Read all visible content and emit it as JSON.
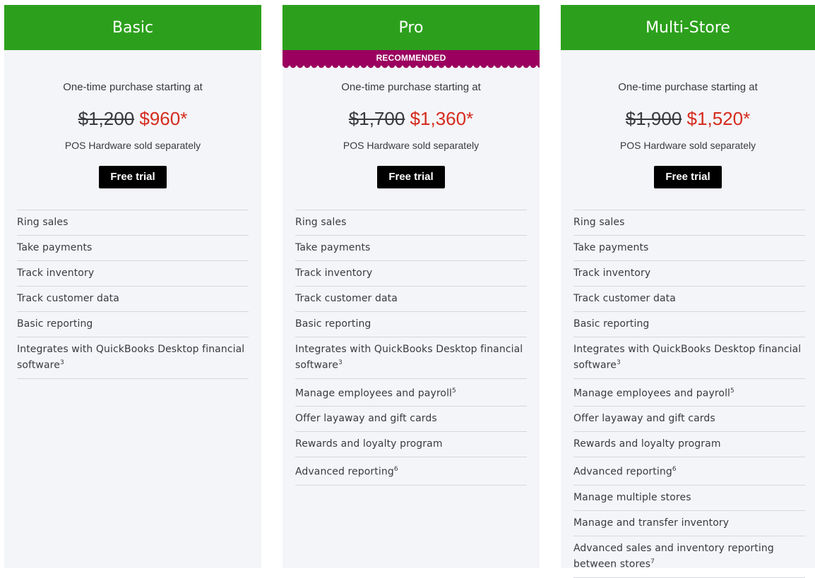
{
  "plans": [
    {
      "name": "Basic",
      "ribbon": null,
      "purchase_label": "One-time purchase starting at",
      "old_price": "$1,200",
      "new_price": "$960*",
      "hardware_note": "POS Hardware sold separately",
      "cta_label": "Free trial",
      "features": [
        {
          "text": "Ring sales",
          "sup": ""
        },
        {
          "text": "Take payments",
          "sup": ""
        },
        {
          "text": "Track inventory",
          "sup": ""
        },
        {
          "text": "Track customer data",
          "sup": ""
        },
        {
          "text": "Basic reporting",
          "sup": ""
        },
        {
          "text": "Integrates with QuickBooks Desktop financial software",
          "sup": "3"
        }
      ]
    },
    {
      "name": "Pro",
      "ribbon": "RECOMMENDED",
      "purchase_label": "One-time purchase starting at",
      "old_price": "$1,700",
      "new_price": "$1,360*",
      "hardware_note": "POS Hardware sold separately",
      "cta_label": "Free trial",
      "features": [
        {
          "text": "Ring sales",
          "sup": ""
        },
        {
          "text": "Take payments",
          "sup": ""
        },
        {
          "text": "Track inventory",
          "sup": ""
        },
        {
          "text": "Track customer data",
          "sup": ""
        },
        {
          "text": "Basic reporting",
          "sup": ""
        },
        {
          "text": "Integrates with QuickBooks Desktop financial software",
          "sup": "3"
        },
        {
          "text": "Manage employees and payroll",
          "sup": "5"
        },
        {
          "text": "Offer layaway and gift cards",
          "sup": ""
        },
        {
          "text": "Rewards and loyalty program",
          "sup": ""
        },
        {
          "text": "Advanced reporting",
          "sup": "6"
        }
      ]
    },
    {
      "name": "Multi-Store",
      "ribbon": null,
      "purchase_label": "One-time purchase starting at",
      "old_price": "$1,900",
      "new_price": "$1,520*",
      "hardware_note": "POS Hardware sold separately",
      "cta_label": "Free trial",
      "features": [
        {
          "text": "Ring sales",
          "sup": ""
        },
        {
          "text": "Take payments",
          "sup": ""
        },
        {
          "text": "Track inventory",
          "sup": ""
        },
        {
          "text": "Track customer data",
          "sup": ""
        },
        {
          "text": "Basic reporting",
          "sup": ""
        },
        {
          "text": "Integrates with QuickBooks Desktop financial software",
          "sup": "3"
        },
        {
          "text": "Manage employees and payroll",
          "sup": "5"
        },
        {
          "text": "Offer layaway and gift cards",
          "sup": ""
        },
        {
          "text": "Rewards and loyalty program",
          "sup": ""
        },
        {
          "text": "Advanced reporting",
          "sup": "6"
        },
        {
          "text": "Manage multiple stores",
          "sup": ""
        },
        {
          "text": "Manage and transfer inventory",
          "sup": ""
        },
        {
          "text": "Advanced sales and inventory reporting between stores",
          "sup": "7"
        }
      ]
    }
  ],
  "colors": {
    "header_green": "#2ca01c",
    "ribbon_magenta": "#9b005f",
    "sale_red": "#d52b1e",
    "card_bg": "#f4f5f8",
    "button_black": "#000000"
  }
}
